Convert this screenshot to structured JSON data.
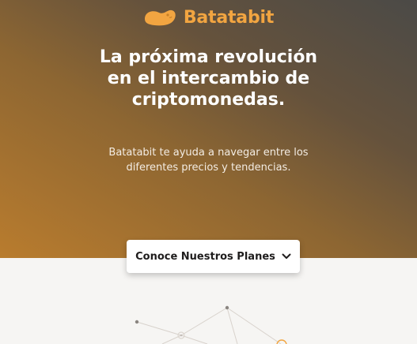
{
  "brand": {
    "name": "Batatabit",
    "logo_color": "#f2a541"
  },
  "hero": {
    "headline_lines": [
      "La próxima revolución",
      "en el intercambio de",
      "criptomonedas."
    ],
    "subtitle_lines": [
      "Batatabit te ayuda a navegar entre los",
      "diferentes precios y tendencias."
    ]
  },
  "cta": {
    "label": "Conoce Nuestros Planes",
    "icon": "chevron-down-icon"
  },
  "colors": {
    "accent": "#f2a541",
    "background_light": "#f6f5f3"
  }
}
